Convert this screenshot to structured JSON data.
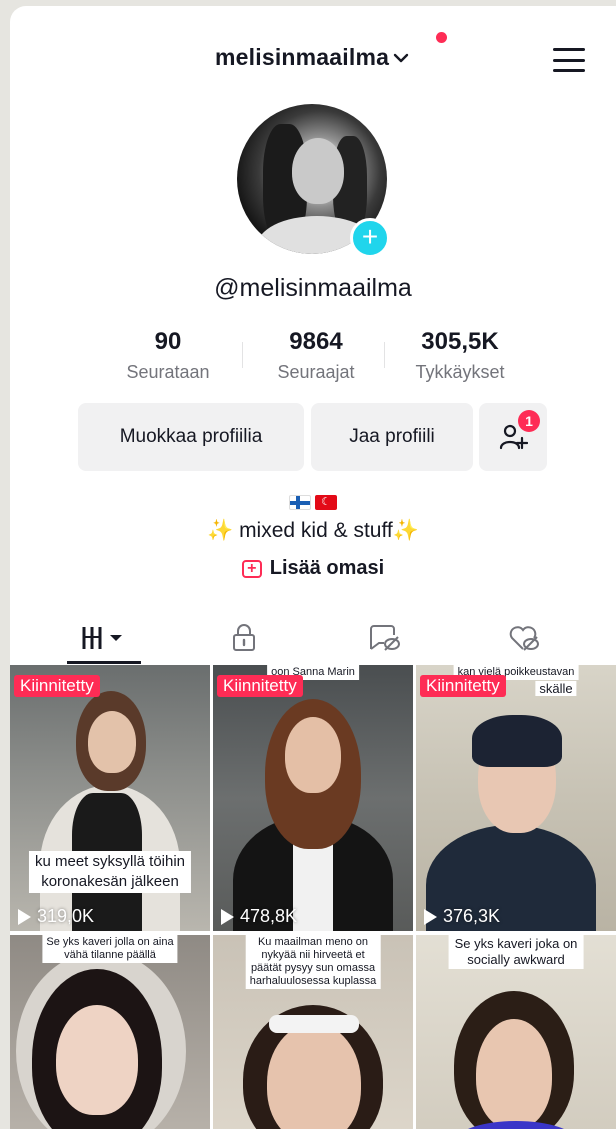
{
  "header": {
    "username": "melisinmaailma",
    "handle": "@melisinmaailma"
  },
  "stats": [
    {
      "value": "90",
      "label": "Seurataan"
    },
    {
      "value": "9864",
      "label": "Seuraajat"
    },
    {
      "value": "305,5K",
      "label": "Tykkäykset"
    }
  ],
  "buttons": {
    "edit_profile": "Muokkaa profiilia",
    "share_profile": "Jaa profiili",
    "friends_badge": "1"
  },
  "bio": {
    "flags": [
      "finland-flag",
      "turkey-flag"
    ],
    "text": " mixed kid & stuff",
    "add_link": "Lisää omasi"
  },
  "tabs": [
    "videos-grid-icon",
    "lock-icon",
    "reposts-icon",
    "liked-icon"
  ],
  "videos": [
    {
      "pinned": "Kiinnitetty",
      "caption": "ku meet syksyllä töihin\nkoronakesän jälkeen",
      "views": "319,0K",
      "top_caption": ""
    },
    {
      "pinned": "Kiinnitetty",
      "caption": "",
      "views": "478,8K",
      "top_caption": "oon Sanna Marin"
    },
    {
      "pinned": "Kiinnitetty",
      "caption": "",
      "views": "376,3K",
      "top_caption": "kan vielä poikkeustavan ...skälle"
    },
    {
      "pinned": "",
      "caption": "",
      "views": "",
      "top_caption": "Se yks kaveri jolla on aina\nvähä tilanne päällä"
    },
    {
      "pinned": "",
      "caption": "",
      "views": "",
      "top_caption": "Ku maailman meno on\nnykyää nii hirveetä et\npäätät pysyy sun omassa\nharhaluulosessa kuplassa"
    },
    {
      "pinned": "",
      "caption": "",
      "views": "",
      "top_caption": "Se yks kaveri joka on\nsocially awkward"
    }
  ],
  "colors": {
    "accent": "#fe2c55",
    "cyan": "#20d5ec",
    "text": "#161823",
    "muted": "#73747b",
    "button_bg": "#f1f1f2"
  }
}
